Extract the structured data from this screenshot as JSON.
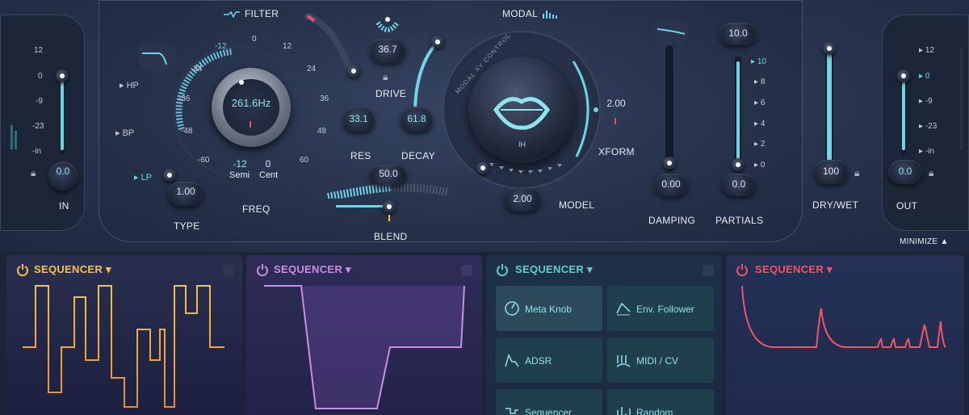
{
  "filter": {
    "title": "FILTER",
    "freq_value": "261.6Hz",
    "freq_label": "FREQ",
    "type_label": "TYPE",
    "type_value": "1.00",
    "modes": [
      "HP",
      "BP",
      "LP"
    ],
    "scale": [
      "-12",
      "0",
      "12",
      "24",
      "36",
      "48",
      "60",
      "-24",
      "-36",
      "-48",
      "-60"
    ],
    "semi_value": "-12",
    "semi_label": "Semi",
    "cent_value": "0",
    "cent_label": "Cent",
    "res_label": "RES",
    "res_value": "33.1"
  },
  "drive": {
    "label": "DRIVE",
    "value": "36.7"
  },
  "decay": {
    "label": "DECAY",
    "value": "61.8"
  },
  "blend": {
    "label": "BLEND",
    "value": "50.0"
  },
  "modal": {
    "title": "MODAL",
    "xy_label": "MODAL XY CONTROL",
    "model_label": "MODEL",
    "model_value": "2.00",
    "xform_label": "XFORM",
    "xform_value": "2.00",
    "center": "IH"
  },
  "damping": {
    "label": "DAMPING",
    "value": "0.00"
  },
  "partials": {
    "label": "PARTIALS",
    "value": "0.0",
    "top_value": "10.0",
    "scale": [
      "10",
      "8",
      "6",
      "4",
      "2",
      "0"
    ]
  },
  "drywet": {
    "label": "DRY/WET",
    "value": "100"
  },
  "input": {
    "label": "IN",
    "value": "0.0",
    "scale": [
      "12",
      "0",
      "-9",
      "-23",
      "-in"
    ]
  },
  "output": {
    "label": "OUT",
    "value": "0.0",
    "scale": [
      "12",
      "0",
      "-9",
      "-23",
      "-in"
    ]
  },
  "minimize": "MINIMIZE ▲",
  "panels": [
    {
      "title": "SEQUENCER",
      "color": "#f2c443"
    },
    {
      "title": "SEQUENCER",
      "color": "#c88ee0"
    },
    {
      "title": "SEQUENCER",
      "color": "#5fd0c8"
    },
    {
      "title": "SEQUENCER",
      "color": "#ef5567"
    }
  ],
  "mod_tiles": [
    "Meta Knob",
    "Env. Follower",
    "ADSR",
    "MIDI / CV",
    "Sequencer",
    "Random"
  ]
}
